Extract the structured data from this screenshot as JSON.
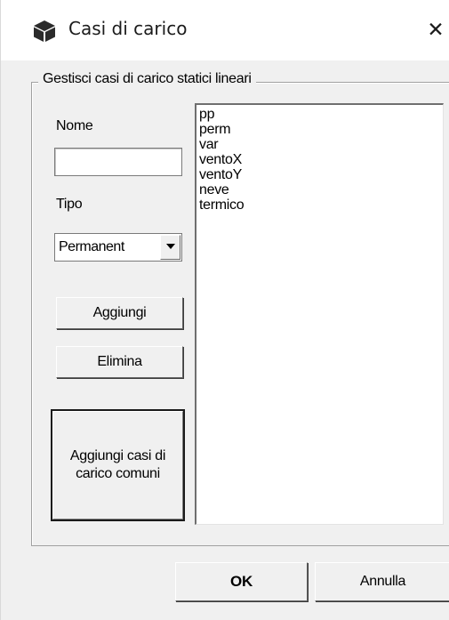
{
  "window": {
    "title": "Casi di carico",
    "app_icon": "cube-icon",
    "close_glyph": "✕"
  },
  "group": {
    "legend": "Gestisci casi di carico statici lineari"
  },
  "form": {
    "name_label": "Nome",
    "name_value": "",
    "type_label": "Tipo",
    "type_selected": "Permanent"
  },
  "buttons": {
    "add": "Aggiungi",
    "delete": "Elimina",
    "add_common": "Aggiungi casi di carico comuni",
    "ok": "OK",
    "cancel": "Annulla"
  },
  "load_cases": [
    "pp",
    "perm",
    "var",
    "ventoX",
    "ventoY",
    "neve",
    "termico"
  ],
  "colors": {
    "dialog_bg": "#f0f0f0",
    "titlebar_bg": "#ffffff",
    "list_bg": "#ffffff"
  }
}
